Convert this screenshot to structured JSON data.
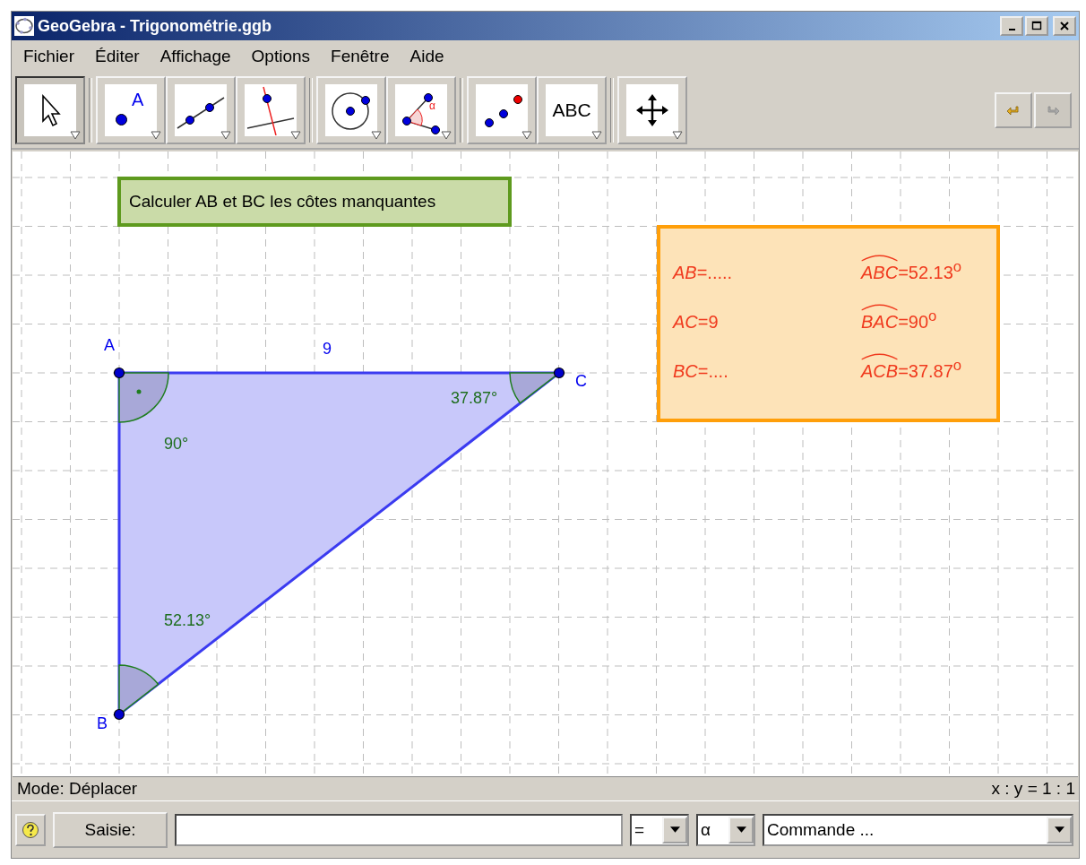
{
  "window": {
    "title": "GeoGebra - Trigonométrie.ggb"
  },
  "menu": [
    "Fichier",
    "Éditer",
    "Affichage",
    "Options",
    "Fenêtre",
    "Aide"
  ],
  "tool_groups": [
    [
      {
        "kind": "move",
        "selected": true
      }
    ],
    [
      {
        "kind": "point",
        "selected": false,
        "label": "A"
      },
      {
        "kind": "line",
        "selected": false
      },
      {
        "kind": "perpendicular",
        "selected": false
      }
    ],
    [
      {
        "kind": "circle",
        "selected": false
      },
      {
        "kind": "angle",
        "selected": false,
        "label": "α"
      }
    ],
    [
      {
        "kind": "reflect",
        "selected": false
      },
      {
        "kind": "text",
        "selected": false,
        "label": "ABC"
      }
    ],
    [
      {
        "kind": "move-view",
        "selected": false
      }
    ]
  ],
  "history": [
    {
      "kind": "undo",
      "disabled": false
    },
    {
      "kind": "redo",
      "disabled": true
    }
  ],
  "canvas": {
    "task": "Calculer AB et BC les côtes manquantes",
    "points": [
      {
        "label": "A"
      },
      {
        "label": "C"
      },
      {
        "label": "B"
      }
    ],
    "segment_label": "9",
    "angle_labels": [
      "90°",
      "37.87°",
      "52.13°"
    ],
    "answers": [
      {
        "side": "*AB*=.....",
        "angle": "ABC",
        "value": "=52.13$^{o}$"
      },
      {
        "side": "*AC*=9",
        "angle": "BAC",
        "value": "=90$^{o}$"
      },
      {
        "side": "*BC*=....",
        "angle": "ACB",
        "value": "=37.87$^{o}$"
      }
    ]
  },
  "status_bar": {
    "mode": "Mode: Déplacer",
    "ratio": "x : y = 1 : 1"
  },
  "input_bar": {
    "button": "Saisie:",
    "symbols": [
      "=",
      "α"
    ],
    "command": "Commande ..."
  }
}
